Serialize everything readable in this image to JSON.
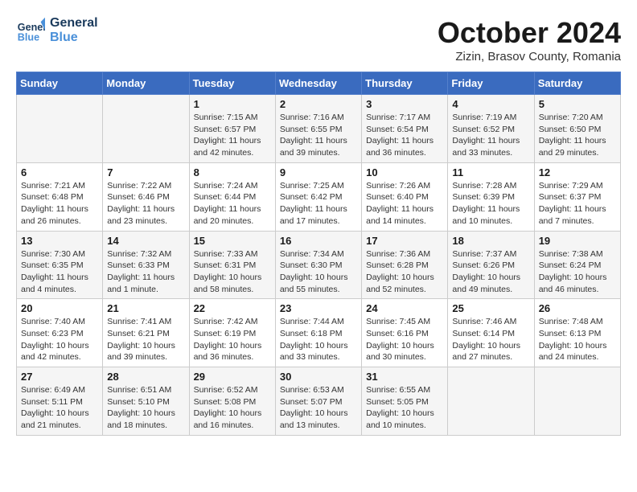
{
  "header": {
    "logo_line1": "General",
    "logo_line2": "Blue",
    "month": "October 2024",
    "location": "Zizin, Brasov County, Romania"
  },
  "days_of_week": [
    "Sunday",
    "Monday",
    "Tuesday",
    "Wednesday",
    "Thursday",
    "Friday",
    "Saturday"
  ],
  "weeks": [
    [
      {
        "day": "",
        "details": ""
      },
      {
        "day": "",
        "details": ""
      },
      {
        "day": "1",
        "details": "Sunrise: 7:15 AM\nSunset: 6:57 PM\nDaylight: 11 hours and 42 minutes."
      },
      {
        "day": "2",
        "details": "Sunrise: 7:16 AM\nSunset: 6:55 PM\nDaylight: 11 hours and 39 minutes."
      },
      {
        "day": "3",
        "details": "Sunrise: 7:17 AM\nSunset: 6:54 PM\nDaylight: 11 hours and 36 minutes."
      },
      {
        "day": "4",
        "details": "Sunrise: 7:19 AM\nSunset: 6:52 PM\nDaylight: 11 hours and 33 minutes."
      },
      {
        "day": "5",
        "details": "Sunrise: 7:20 AM\nSunset: 6:50 PM\nDaylight: 11 hours and 29 minutes."
      }
    ],
    [
      {
        "day": "6",
        "details": "Sunrise: 7:21 AM\nSunset: 6:48 PM\nDaylight: 11 hours and 26 minutes."
      },
      {
        "day": "7",
        "details": "Sunrise: 7:22 AM\nSunset: 6:46 PM\nDaylight: 11 hours and 23 minutes."
      },
      {
        "day": "8",
        "details": "Sunrise: 7:24 AM\nSunset: 6:44 PM\nDaylight: 11 hours and 20 minutes."
      },
      {
        "day": "9",
        "details": "Sunrise: 7:25 AM\nSunset: 6:42 PM\nDaylight: 11 hours and 17 minutes."
      },
      {
        "day": "10",
        "details": "Sunrise: 7:26 AM\nSunset: 6:40 PM\nDaylight: 11 hours and 14 minutes."
      },
      {
        "day": "11",
        "details": "Sunrise: 7:28 AM\nSunset: 6:39 PM\nDaylight: 11 hours and 10 minutes."
      },
      {
        "day": "12",
        "details": "Sunrise: 7:29 AM\nSunset: 6:37 PM\nDaylight: 11 hours and 7 minutes."
      }
    ],
    [
      {
        "day": "13",
        "details": "Sunrise: 7:30 AM\nSunset: 6:35 PM\nDaylight: 11 hours and 4 minutes."
      },
      {
        "day": "14",
        "details": "Sunrise: 7:32 AM\nSunset: 6:33 PM\nDaylight: 11 hours and 1 minute."
      },
      {
        "day": "15",
        "details": "Sunrise: 7:33 AM\nSunset: 6:31 PM\nDaylight: 10 hours and 58 minutes."
      },
      {
        "day": "16",
        "details": "Sunrise: 7:34 AM\nSunset: 6:30 PM\nDaylight: 10 hours and 55 minutes."
      },
      {
        "day": "17",
        "details": "Sunrise: 7:36 AM\nSunset: 6:28 PM\nDaylight: 10 hours and 52 minutes."
      },
      {
        "day": "18",
        "details": "Sunrise: 7:37 AM\nSunset: 6:26 PM\nDaylight: 10 hours and 49 minutes."
      },
      {
        "day": "19",
        "details": "Sunrise: 7:38 AM\nSunset: 6:24 PM\nDaylight: 10 hours and 46 minutes."
      }
    ],
    [
      {
        "day": "20",
        "details": "Sunrise: 7:40 AM\nSunset: 6:23 PM\nDaylight: 10 hours and 42 minutes."
      },
      {
        "day": "21",
        "details": "Sunrise: 7:41 AM\nSunset: 6:21 PM\nDaylight: 10 hours and 39 minutes."
      },
      {
        "day": "22",
        "details": "Sunrise: 7:42 AM\nSunset: 6:19 PM\nDaylight: 10 hours and 36 minutes."
      },
      {
        "day": "23",
        "details": "Sunrise: 7:44 AM\nSunset: 6:18 PM\nDaylight: 10 hours and 33 minutes."
      },
      {
        "day": "24",
        "details": "Sunrise: 7:45 AM\nSunset: 6:16 PM\nDaylight: 10 hours and 30 minutes."
      },
      {
        "day": "25",
        "details": "Sunrise: 7:46 AM\nSunset: 6:14 PM\nDaylight: 10 hours and 27 minutes."
      },
      {
        "day": "26",
        "details": "Sunrise: 7:48 AM\nSunset: 6:13 PM\nDaylight: 10 hours and 24 minutes."
      }
    ],
    [
      {
        "day": "27",
        "details": "Sunrise: 6:49 AM\nSunset: 5:11 PM\nDaylight: 10 hours and 21 minutes."
      },
      {
        "day": "28",
        "details": "Sunrise: 6:51 AM\nSunset: 5:10 PM\nDaylight: 10 hours and 18 minutes."
      },
      {
        "day": "29",
        "details": "Sunrise: 6:52 AM\nSunset: 5:08 PM\nDaylight: 10 hours and 16 minutes."
      },
      {
        "day": "30",
        "details": "Sunrise: 6:53 AM\nSunset: 5:07 PM\nDaylight: 10 hours and 13 minutes."
      },
      {
        "day": "31",
        "details": "Sunrise: 6:55 AM\nSunset: 5:05 PM\nDaylight: 10 hours and 10 minutes."
      },
      {
        "day": "",
        "details": ""
      },
      {
        "day": "",
        "details": ""
      }
    ]
  ]
}
